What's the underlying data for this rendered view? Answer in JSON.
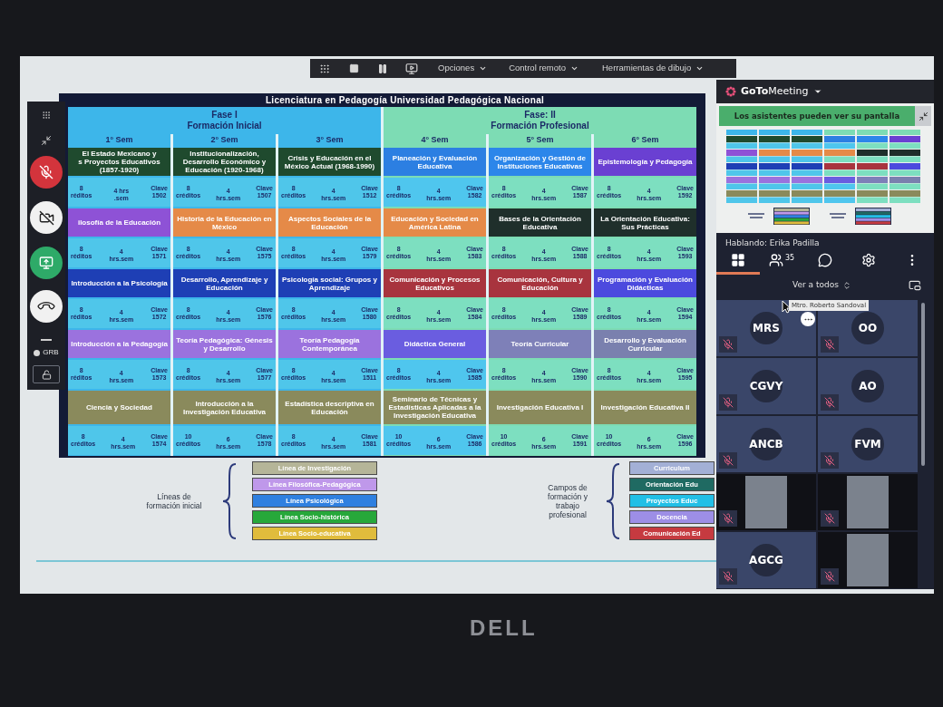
{
  "toolbar": {
    "menus": [
      {
        "label": "Opciones"
      },
      {
        "label": "Control remoto"
      },
      {
        "label": "Herramientas de dibujo"
      }
    ]
  },
  "side_controls": {
    "microphone_muted": true,
    "camera_on": false,
    "screen_sharing": true,
    "presenter": "GRB"
  },
  "slide": {
    "title": "Licenciatura en Pedagogía Universidad Pedagógica Nacional",
    "phases": [
      {
        "label": "Fase I",
        "subtitle": "Formación Inicial",
        "color": "#3db6ea",
        "semesters": [
          {
            "label": "1° Sem",
            "courses": [
              {
                "title": "El Estado Mexicano y\ns Proyectos Educativos\n(1857-1920)",
                "color": "#1f4a2e",
                "details": {
                  "color": "#4fc6ea",
                  "credits": "8",
                  "credits_label": "réditos",
                  "hours": "4 hrs",
                  "hours_label": ".sem",
                  "key_label": "Clave",
                  "key": "1502"
                }
              },
              {
                "title": "ilosofía de la Educación",
                "color": "#8e52d6",
                "details": {
                  "color": "#4fc6ea",
                  "credits": "8",
                  "credits_label": "réditos",
                  "hours": "4",
                  "hours_label": "hrs.sem",
                  "key_label": "Clave",
                  "key": "1571"
                }
              },
              {
                "title": "Introducción a la Psicología",
                "color": "#1e3fb5",
                "details": {
                  "color": "#4fc6ea",
                  "credits": "8",
                  "credits_label": "réditos",
                  "hours": "4",
                  "hours_label": "hrs.sem",
                  "key_label": "Clave",
                  "key": "1572"
                }
              },
              {
                "title": "Introducción a la Pedagogía",
                "color": "#9b72de",
                "details": {
                  "color": "#4fc6ea",
                  "credits": "8",
                  "credits_label": "réditos",
                  "hours": "4",
                  "hours_label": "hrs.sem",
                  "key_label": "Clave",
                  "key": "1573"
                }
              },
              {
                "title": "Ciencia y Sociedad",
                "color": "#8a8a5c",
                "details": {
                  "color": "#4fc6ea",
                  "credits": "8",
                  "credits_label": "créditos",
                  "hours": "4",
                  "hours_label": "hrs.sem",
                  "key_label": "Clave",
                  "key": "1574"
                }
              }
            ]
          },
          {
            "label": "2° Sem",
            "courses": [
              {
                "title": "Institucionalización, Desarrollo Económico y Educación (1920-1968)",
                "color": "#1f4a2e",
                "details": {
                  "color": "#4fc6ea",
                  "credits": "8",
                  "credits_label": "créditos",
                  "hours": "4",
                  "hours_label": "hrs.sem",
                  "key_label": "Clave",
                  "key": "1507"
                }
              },
              {
                "title": "Historia de la Educación en México",
                "color": "#e58a48",
                "details": {
                  "color": "#4fc6ea",
                  "credits": "8",
                  "credits_label": "créditos",
                  "hours": "4",
                  "hours_label": "hrs.sem",
                  "key_label": "Clave",
                  "key": "1575"
                }
              },
              {
                "title": "Desarrollo, Aprendizaje y Educación",
                "color": "#1e3fb5",
                "details": {
                  "color": "#4fc6ea",
                  "credits": "8",
                  "credits_label": "créditos",
                  "hours": "4",
                  "hours_label": "hrs.sem",
                  "key_label": "Clave",
                  "key": "1576"
                }
              },
              {
                "title": "Teoría Pedagógica: Génesis y Desarrollo",
                "color": "#9b72de",
                "details": {
                  "color": "#4fc6ea",
                  "credits": "8",
                  "credits_label": "créditos",
                  "hours": "4",
                  "hours_label": "hrs.sem",
                  "key_label": "Clave",
                  "key": "1577"
                }
              },
              {
                "title": "Introducción a la Investigación Educativa",
                "color": "#8a8a5c",
                "details": {
                  "color": "#4fc6ea",
                  "credits": "10",
                  "credits_label": "créditos",
                  "hours": "6",
                  "hours_label": "hrs.sem",
                  "key_label": "Clave",
                  "key": "1578"
                }
              }
            ]
          },
          {
            "label": "3° Sem",
            "courses": [
              {
                "title": "Crisis y Educación en el México Actual (1968-1990)",
                "color": "#1f4a2e",
                "details": {
                  "color": "#4fc6ea",
                  "credits": "8",
                  "credits_label": "créditos",
                  "hours": "4",
                  "hours_label": "hrs.sem",
                  "key_label": "Clave",
                  "key": "1512"
                }
              },
              {
                "title": "Aspectos Sociales de la Educación",
                "color": "#e58a48",
                "details": {
                  "color": "#4fc6ea",
                  "credits": "8",
                  "credits_label": "créditos",
                  "hours": "4",
                  "hours_label": "hrs.sem",
                  "key_label": "Clave",
                  "key": "1579"
                }
              },
              {
                "title": "Psicología social: Grupos y Aprendizaje",
                "color": "#1e3fb5",
                "details": {
                  "color": "#4fc6ea",
                  "credits": "8",
                  "credits_label": "créditos",
                  "hours": "4",
                  "hours_label": "hrs.sem",
                  "key_label": "Clave",
                  "key": "1580"
                }
              },
              {
                "title": "Teoría Pedagogía Contemporánea",
                "color": "#9b72de",
                "details": {
                  "color": "#4fc6ea",
                  "credits": "8",
                  "credits_label": "créditos",
                  "hours": "4",
                  "hours_label": "hrs.sem",
                  "key_label": "Clave",
                  "key": "1511"
                }
              },
              {
                "title": "Estadística descriptiva en Educación",
                "color": "#8a8a5c",
                "details": {
                  "color": "#4fc6ea",
                  "credits": "8",
                  "credits_label": "créditos",
                  "hours": "4",
                  "hours_label": "hrs.sem",
                  "key_label": "Clave",
                  "key": "1581"
                }
              }
            ]
          }
        ]
      },
      {
        "label": "Fase: II",
        "subtitle": "Formación Profesional",
        "color": "#7ddcb4",
        "semesters": [
          {
            "label": "4° Sem",
            "courses": [
              {
                "title": "Planeación y Evaluación Educativa",
                "color": "#2c7fe2",
                "details": {
                  "color": "#4fc6ee",
                  "credits": "8",
                  "credits_label": "créditos",
                  "hours": "4",
                  "hours_label": "hrs.sem",
                  "key_label": "Clave",
                  "key": "1582"
                }
              },
              {
                "title": "Educación y Sociedad en América Latina",
                "color": "#e58a48",
                "details": {
                  "color": "#7ddfc0",
                  "credits": "8",
                  "credits_label": "créditos",
                  "hours": "4",
                  "hours_label": "hrs.sem",
                  "key_label": "Clave",
                  "key": "1583"
                }
              },
              {
                "title": "Comunicación y Procesos Educativos",
                "color": "#a8343e",
                "details": {
                  "color": "#7ddfc0",
                  "credits": "8",
                  "credits_label": "créditos",
                  "hours": "4",
                  "hours_label": "hrs.sem",
                  "key_label": "Clave",
                  "key": "1584"
                }
              },
              {
                "title": "Didáctica General",
                "color": "#6a5de0",
                "details": {
                  "color": "#4fc6ee",
                  "credits": "8",
                  "credits_label": "créditos",
                  "hours": "4",
                  "hours_label": "hrs.sem",
                  "key_label": "Clave",
                  "key": "1585"
                }
              },
              {
                "title": "Seminario de Técnicas y Estadísticas Aplicadas a la Investigación Educativa",
                "color": "#8a8a5c",
                "details": {
                  "color": "#4fc6ee",
                  "credits": "10",
                  "credits_label": "créditos",
                  "hours": "6",
                  "hours_label": "hrs.sem",
                  "key_label": "Clave",
                  "key": "1586"
                }
              }
            ]
          },
          {
            "label": "5° Sem",
            "courses": [
              {
                "title": "Organización y Gestión de Instituciones Educativas",
                "color": "#2c86ea",
                "details": {
                  "color": "#7ddfc0",
                  "credits": "8",
                  "credits_label": "créditos",
                  "hours": "4",
                  "hours_label": "hrs.sem",
                  "key_label": "Clave",
                  "key": "1587"
                }
              },
              {
                "title": "Bases de la Orientación Educativa",
                "color": "#1f2f2b",
                "details": {
                  "color": "#7ddfc0",
                  "credits": "8",
                  "credits_label": "créditos",
                  "hours": "4",
                  "hours_label": "hrs.sem",
                  "key_label": "Clave",
                  "key": "1588"
                }
              },
              {
                "title": "Comunicación, Cultura y Educación",
                "color": "#a8343e",
                "details": {
                  "color": "#7ddfc0",
                  "credits": "8",
                  "credits_label": "créditos",
                  "hours": "4",
                  "hours_label": "hrs.sem",
                  "key_label": "Clave",
                  "key": "1589"
                }
              },
              {
                "title": "Teoría Curricular",
                "color": "#7e80b8",
                "details": {
                  "color": "#7ddfc0",
                  "credits": "8",
                  "credits_label": "créditos",
                  "hours": "4",
                  "hours_label": "hrs.sem",
                  "key_label": "Clave",
                  "key": "1590"
                }
              },
              {
                "title": "Investigación Educativa I",
                "color": "#8a8a5c",
                "details": {
                  "color": "#7ddfc0",
                  "credits": "10",
                  "credits_label": "créditos",
                  "hours": "6",
                  "hours_label": "hrs.sem",
                  "key_label": "Clave",
                  "key": "1591"
                }
              }
            ]
          },
          {
            "label": "6° Sem",
            "courses": [
              {
                "title": "Epistemología y Pedagogía",
                "color": "#6a40d2",
                "details": {
                  "color": "#7ddfc0",
                  "credits": "8",
                  "credits_label": "créditos",
                  "hours": "4",
                  "hours_label": "hrs.sem",
                  "key_label": "Clave",
                  "key": "1592"
                }
              },
              {
                "title": "La Orientación Educativa: Sus Prácticas",
                "color": "#1f2f2b",
                "details": {
                  "color": "#7ddfc0",
                  "credits": "8",
                  "credits_label": "créditos",
                  "hours": "4",
                  "hours_label": "hrs.sem",
                  "key_label": "Clave",
                  "key": "1593"
                }
              },
              {
                "title": "Programación y Evaluación Didácticas",
                "color": "#4c4ade",
                "details": {
                  "color": "#7ddfc0",
                  "credits": "8",
                  "credits_label": "créditos",
                  "hours": "4",
                  "hours_label": "hrs.sem",
                  "key_label": "Clave",
                  "key": "1594"
                }
              },
              {
                "title": "Desarrollo y Evaluación Curricular",
                "color": "#7a80ae",
                "details": {
                  "color": "#7ddfc0",
                  "credits": "8",
                  "credits_label": "créditos",
                  "hours": "4",
                  "hours_label": "hrs.sem",
                  "key_label": "Clave",
                  "key": "1595"
                }
              },
              {
                "title": "Investigación Educativa II",
                "color": "#8a8a5c",
                "details": {
                  "color": "#7ddfc0",
                  "credits": "10",
                  "credits_label": "créditos",
                  "hours": "6",
                  "hours_label": "hrs.sem",
                  "key_label": "Clave",
                  "key": "1596"
                }
              }
            ]
          }
        ]
      }
    ],
    "legends": [
      {
        "label": "Líneas de\nformación inicial",
        "items": [
          {
            "label": "Línea de Investigación",
            "color": "#b5b598"
          },
          {
            "label": "Línea Filosófica-Pedagógica",
            "color": "#bf98ea"
          },
          {
            "label": "Línea Psicológica",
            "color": "#2f80e0"
          },
          {
            "label": "Línea Socio-histórica",
            "color": "#27a83a"
          },
          {
            "label": "Línea Socio-educativa",
            "color": "#e0bc3c"
          }
        ]
      },
      {
        "label": "Campos de\nformación y\ntrabajo\nprofesional",
        "items": [
          {
            "label": "Curriculum",
            "color": "#a3b0d6"
          },
          {
            "label": "Orientación Edu",
            "color": "#1f6a62"
          },
          {
            "label": "Proyectos Educ",
            "color": "#22bfe6"
          },
          {
            "label": "Docencia",
            "color": "#9d8ee6"
          },
          {
            "label": "Comunicación Ed",
            "color": "#c63a40"
          }
        ]
      }
    ]
  },
  "meeting_panel": {
    "brand": "**GoTo**Meeting",
    "banner": "Los asistentes pueden ver su pantalla",
    "speaking": "Hablando: Erika Padilla",
    "tabs": [
      {
        "kind": "grid",
        "selected": true
      },
      {
        "kind": "people",
        "count": "35",
        "selected": false
      },
      {
        "kind": "chat",
        "selected": false
      },
      {
        "kind": "settings",
        "selected": false
      },
      {
        "kind": "more",
        "selected": false
      }
    ],
    "view_filter": "Ver a todos",
    "tooltip": "Mtro. Roberto Sandoval",
    "participants": [
      {
        "kind": "initials",
        "initials": "MRS",
        "muted": true
      },
      {
        "kind": "initials",
        "initials": "OO",
        "muted": true
      },
      {
        "kind": "initials",
        "initials": "CGVY",
        "muted": true
      },
      {
        "kind": "initials",
        "initials": "AO",
        "muted": true
      },
      {
        "kind": "initials",
        "initials": "ANCB",
        "muted": true
      },
      {
        "kind": "initials",
        "initials": "FVM",
        "muted": true
      },
      {
        "kind": "video",
        "muted": true
      },
      {
        "kind": "video",
        "muted": true
      },
      {
        "kind": "initials",
        "initials": "AGCG",
        "muted": true
      },
      {
        "kind": "video",
        "muted": true
      }
    ]
  },
  "bezel": {
    "logo": "DELL"
  }
}
